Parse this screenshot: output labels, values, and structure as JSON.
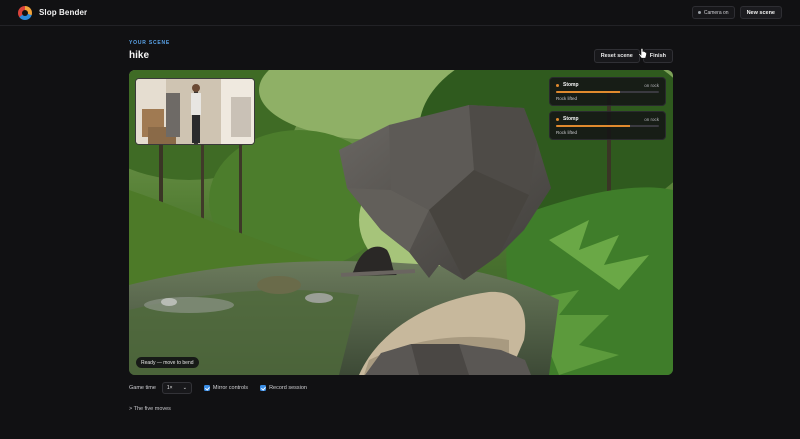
{
  "app": {
    "name": "Slop Bender",
    "camera_chip": "Camera on",
    "new_scene_label": "New scene"
  },
  "scene": {
    "eyebrow": "YOUR SCENE",
    "title": "hike",
    "reset_label": "Reset scene",
    "finish_label": "Finish"
  },
  "hud": [
    {
      "move": "Stomp",
      "state": "on rock",
      "progress": 0.62,
      "note": "Rock lifted"
    },
    {
      "move": "Stomp",
      "state": "on rock",
      "progress": 0.72,
      "note": "Rock lifted"
    }
  ],
  "status": "Ready — move to bend",
  "controls": {
    "game_time_label": "Game time",
    "speed_value": "1×",
    "mirror_label": "Mirror controls",
    "mirror_checked": true,
    "record_label": "Record session",
    "record_checked": true
  },
  "moves_toggle": "> The five moves",
  "colors": {
    "accent": "#3a8ee6",
    "hud_accent": "#e08a2e",
    "eyebrow": "#5aa4ea"
  },
  "icons": [
    "app-logo-icon",
    "camera-dot-icon",
    "chevron-down-icon",
    "checkbox-icon",
    "pointer-cursor-icon"
  ]
}
